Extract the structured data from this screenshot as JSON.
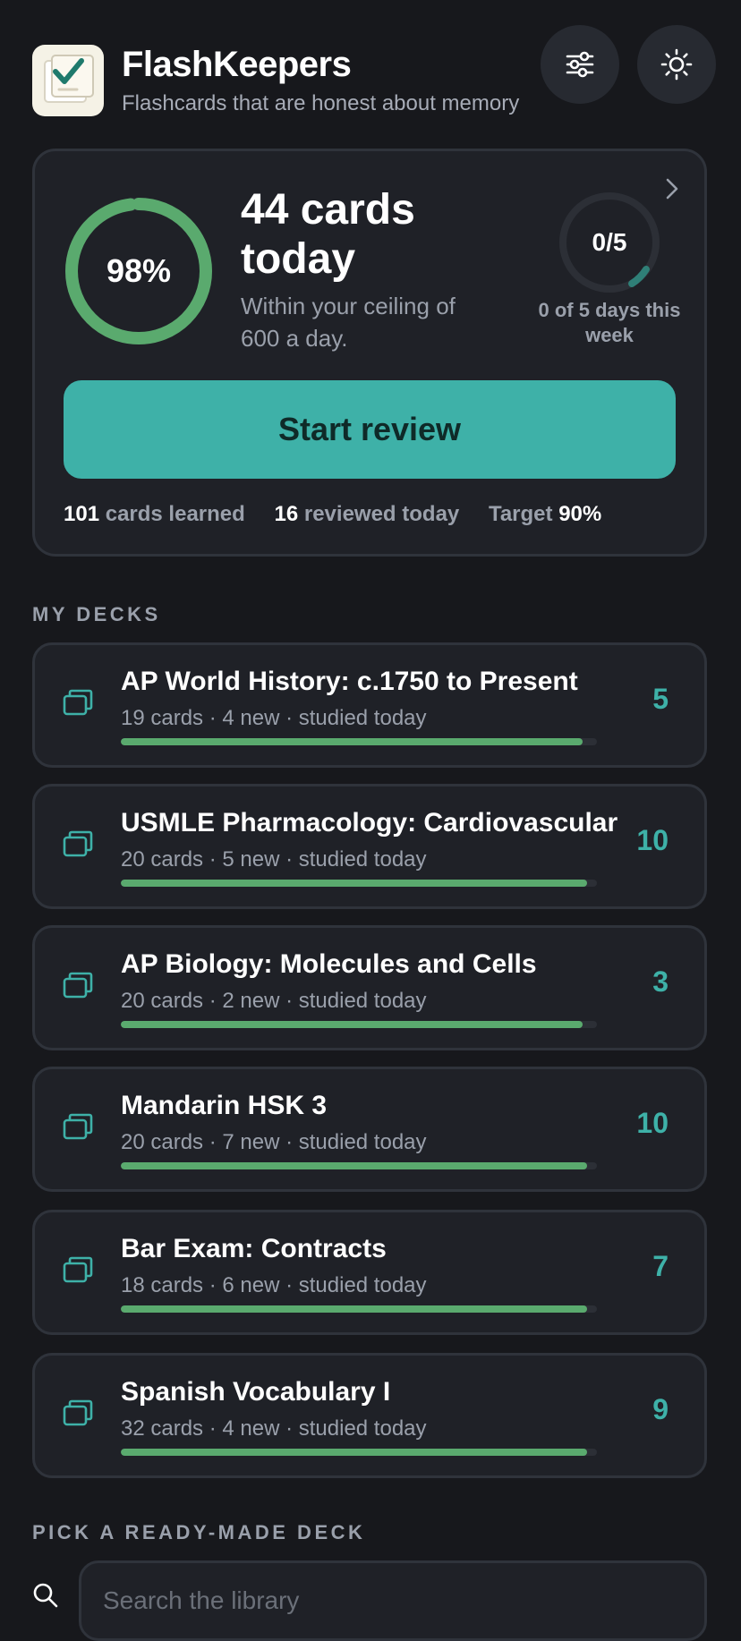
{
  "app": {
    "title": "FlashKeepers",
    "subtitle": "Flashcards that are honest about memory"
  },
  "summary": {
    "retention_label": "98%",
    "retention_fraction": 0.98,
    "cards_today": "44 cards today",
    "ceiling_text": "Within your ceiling of 600 a day.",
    "week_progress_label": "0/5",
    "week_caption": "0 of 5 days this week",
    "start_label": "Start review",
    "stats": {
      "learned_num": "101",
      "learned_label": "cards learned",
      "reviewed_num": "16",
      "reviewed_label": "reviewed today",
      "target_label": "Target",
      "target_num": "90%"
    }
  },
  "sections": {
    "my_decks": "MY DECKS",
    "ready_made": "PICK A READY-MADE DECK"
  },
  "decks": [
    {
      "title": "AP World History: c.1750 to Present",
      "meta": "19 cards · 4 new · studied today",
      "due": "5",
      "progress": 0.97
    },
    {
      "title": "USMLE Pharmacology: Cardiovascular",
      "meta": "20 cards · 5 new · studied today",
      "due": "10",
      "progress": 0.98
    },
    {
      "title": "AP Biology: Molecules and Cells",
      "meta": "20 cards · 2 new · studied today",
      "due": "3",
      "progress": 0.97
    },
    {
      "title": "Mandarin HSK 3",
      "meta": "20 cards · 7 new · studied today",
      "due": "10",
      "progress": 0.98
    },
    {
      "title": "Bar Exam: Contracts",
      "meta": "18 cards · 6 new · studied today",
      "due": "7",
      "progress": 0.98
    },
    {
      "title": "Spanish Vocabulary I",
      "meta": "32 cards · 4 new · studied today",
      "due": "9",
      "progress": 0.98
    }
  ],
  "search": {
    "placeholder": "Search the library"
  },
  "colors": {
    "background": "#17181c",
    "card": "#1f2127",
    "accent_teal": "#3eb1a8",
    "progress_green": "#5aaa6e"
  }
}
